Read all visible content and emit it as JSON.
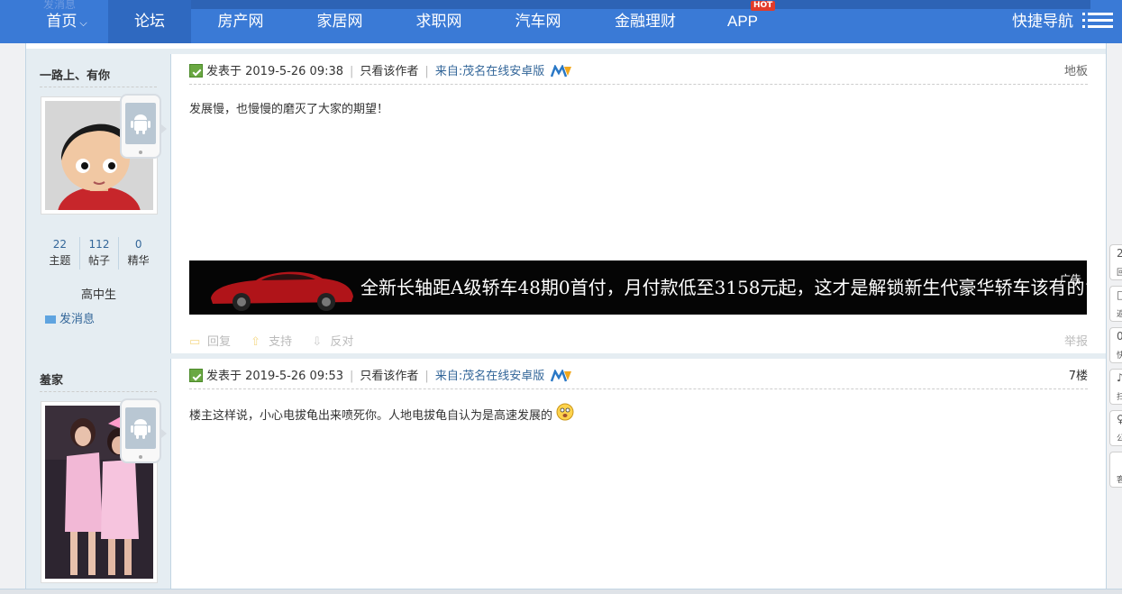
{
  "nav": {
    "ghost_text": "发消息",
    "items": [
      {
        "label": "首页",
        "has_caret": true
      },
      {
        "label": "论坛"
      },
      {
        "label": "房产网"
      },
      {
        "label": "家居网"
      },
      {
        "label": "求职网"
      },
      {
        "label": "汽车网"
      },
      {
        "label": "金融理财"
      },
      {
        "label": "APP",
        "badge": "HOT"
      }
    ],
    "caret": "⌵",
    "quick_nav": "快捷导航"
  },
  "posts": [
    {
      "author": "一路上、有你",
      "stats": [
        {
          "value": "22",
          "label": "主题"
        },
        {
          "value": "112",
          "label": "帖子"
        },
        {
          "value": "0",
          "label": "精华"
        }
      ],
      "rank": "高中生",
      "send_msg": "发消息",
      "posted_label": "发表于 2019-5-26 09:38",
      "only_author": "只看该作者",
      "from": "来自:茂名在线安卓版",
      "floor": "地板",
      "content": "发展慢，也慢慢的磨灭了大家的期望！",
      "actions": {
        "reply": "回复",
        "support": "支持",
        "oppose": "反对",
        "report": "举报"
      }
    },
    {
      "author": "羞家",
      "posted_label": "发表于 2019-5-26 09:53",
      "only_author": "只看该作者",
      "from": "来自:茂名在线安卓版",
      "floor": "7楼",
      "content": "楼主这样说，小心电拔龟出来喷死你。人地电拔龟自认为是高速发展的"
    }
  ],
  "ad": {
    "text": "全新长轴距A级轿车48期0首付，月付款低至3158元起，这才是解锁新生代豪华轿车该有的“姿势",
    "label": "广告"
  },
  "right_tools": [
    {
      "icon": "2",
      "label": "回"
    },
    {
      "icon": "□",
      "label": "返"
    },
    {
      "icon": "0",
      "label": "快"
    },
    {
      "icon": "♪",
      "label": "扫"
    },
    {
      "icon": "♀",
      "label": "公"
    },
    {
      "icon": "",
      "label": "客"
    }
  ],
  "colors": {
    "nav_bg": "#3a7ad6",
    "side_bg": "#e5edf2",
    "link": "#336699",
    "hot": "#e23b2a"
  }
}
